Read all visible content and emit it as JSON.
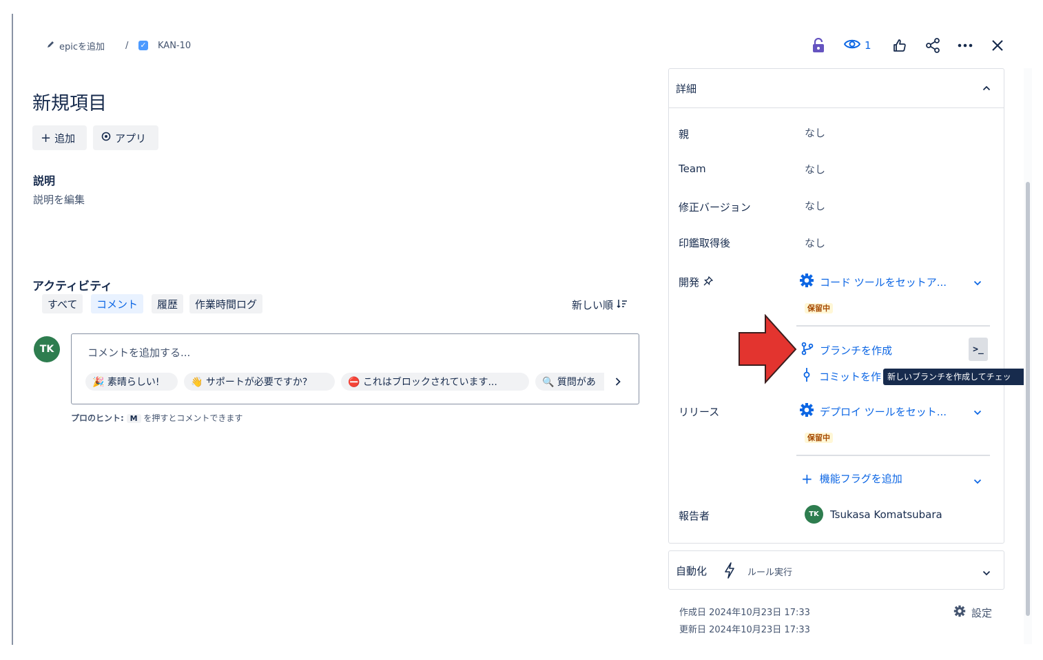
{
  "breadcrumb": {
    "epic_label": "epicを追加",
    "separator": "/",
    "issue_key": "KAN-10"
  },
  "header_actions": {
    "watch_count": "1"
  },
  "issue": {
    "title": "新規項目",
    "add_button": "追加",
    "apps_button": "アプリ"
  },
  "description": {
    "heading": "説明",
    "placeholder": "説明を編集"
  },
  "activity": {
    "heading": "アクティビティ",
    "tabs": [
      "すべて",
      "コメント",
      "履歴",
      "作業時間ログ"
    ],
    "active_tab": "コメント",
    "sort_label": "新しい順"
  },
  "comment": {
    "avatar_initials": "TK",
    "placeholder": "コメントを追加する...",
    "suggestions": [
      "🎉 素晴らしい!",
      "👋 サポートが必要ですか?",
      "⛔ これはブロックされています...",
      "🔍 質問があ"
    ],
    "hint_prefix": "プロのヒント:",
    "hint_key": "M",
    "hint_suffix": "を押すとコメントできます"
  },
  "details": {
    "heading": "詳細",
    "fields": [
      {
        "label": "親",
        "value": "なし"
      },
      {
        "label": "Team",
        "value": "なし"
      },
      {
        "label": "修正バージョン",
        "value": "なし"
      },
      {
        "label": "印鑑取得後",
        "value": "なし"
      }
    ],
    "development": {
      "label": "開発",
      "code_tool": "コード ツールをセットア...",
      "status": "保留中",
      "create_branch": "ブランチを作成",
      "create_commit": "コミットを作",
      "tooltip": "新しいブランチを作成してチェッ"
    },
    "release": {
      "label": "リリース",
      "deploy_tool": "デプロイ ツールをセット...",
      "status": "保留中",
      "add_flag": "機能フラグを追加"
    },
    "reporter": {
      "label": "報告者",
      "initials": "TK",
      "name": "Tsukasa Komatsubara"
    }
  },
  "automation": {
    "heading": "自動化",
    "rule_label": "ルール実行"
  },
  "footer": {
    "created": "作成日 2024年10月23日 17:33",
    "updated": "更新日 2024年10月23日 17:33",
    "settings": "設定"
  },
  "colors": {
    "accent": "#0c66e4",
    "arrow": "#e3342f",
    "avatar": "#2e7d4f",
    "lock": "#6554c0"
  }
}
